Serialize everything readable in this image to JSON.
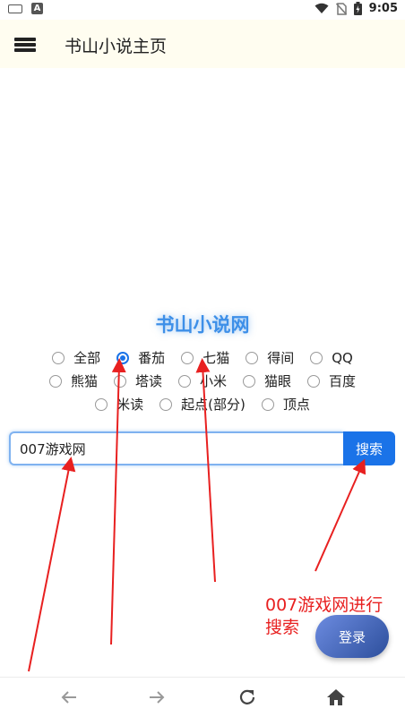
{
  "status_bar": {
    "time": "9:05",
    "left_icons": [
      "keyboard-icon",
      "a-icon"
    ],
    "right_icons": [
      "wifi-icon",
      "no-sim-icon",
      "battery-icon"
    ]
  },
  "app_bar": {
    "title": "书山小说主页",
    "menu_icon": "menu-icon"
  },
  "site": {
    "title": "书山小说网"
  },
  "sources": {
    "rows": [
      [
        {
          "label": "全部",
          "checked": false
        },
        {
          "label": "番茄",
          "checked": true
        },
        {
          "label": "七猫",
          "checked": false
        },
        {
          "label": "得间",
          "checked": false
        },
        {
          "label": "QQ",
          "checked": false
        }
      ],
      [
        {
          "label": "熊猫",
          "checked": false
        },
        {
          "label": "塔读",
          "checked": false
        },
        {
          "label": "小米",
          "checked": false
        },
        {
          "label": "猫眼",
          "checked": false
        },
        {
          "label": "百度",
          "checked": false
        }
      ],
      [
        {
          "label": "米读",
          "checked": false
        },
        {
          "label": "起点(部分)",
          "checked": false
        },
        {
          "label": "顶点",
          "checked": false
        }
      ]
    ]
  },
  "search": {
    "value": "007游戏网",
    "button_label": "搜索"
  },
  "annotation": {
    "line1": "007游戏网进行",
    "line2": "搜索",
    "color": "#e82020"
  },
  "login": {
    "label": "登录"
  },
  "bottom_nav": {
    "icons": [
      "back-arrow-icon",
      "forward-arrow-icon",
      "refresh-icon",
      "home-icon"
    ]
  },
  "colors": {
    "accent": "#1a73e8",
    "title_glow": "#3d8fe8",
    "appbar_bg": "#fffdf0"
  }
}
